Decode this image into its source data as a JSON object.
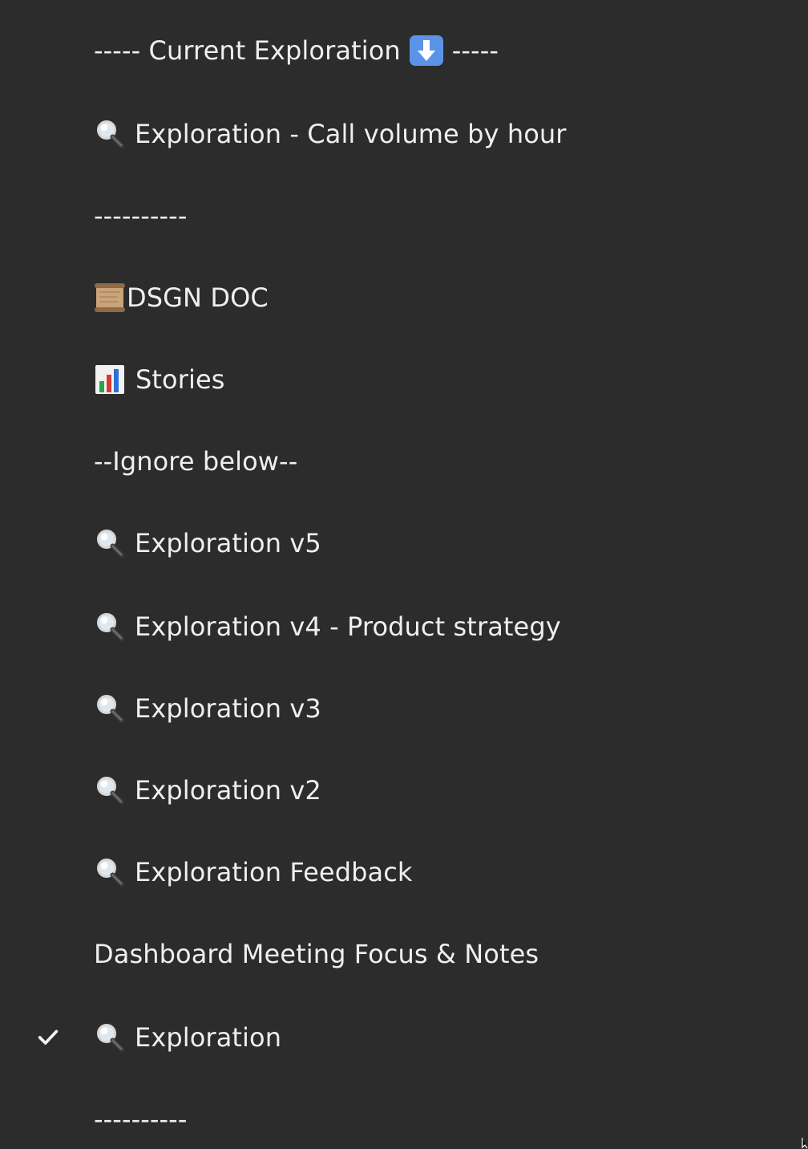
{
  "menu": {
    "items": [
      {
        "prefix": "----- Current Exploration",
        "suffix": "-----",
        "icon": "down-arrow-icon"
      },
      {
        "label": "Exploration - Call volume by hour",
        "icon": "magnifying-glass-icon"
      },
      {
        "label": "----------"
      },
      {
        "label": "DSGN DOC",
        "icon": "scroll-icon"
      },
      {
        "label": "Stories",
        "icon": "bar-chart-icon"
      },
      {
        "label": "--Ignore below--"
      },
      {
        "label": "Exploration v5",
        "icon": "magnifying-glass-icon"
      },
      {
        "label": "Exploration v4 - Product strategy",
        "icon": "magnifying-glass-icon"
      },
      {
        "label": "Exploration v3",
        "icon": "magnifying-glass-icon"
      },
      {
        "label": "Exploration v2",
        "icon": "magnifying-glass-icon"
      },
      {
        "label": "Exploration Feedback",
        "icon": "magnifying-glass-icon"
      },
      {
        "label": "Dashboard Meeting Focus & Notes"
      },
      {
        "label": "Exploration",
        "icon": "magnifying-glass-icon",
        "checked": true,
        "check_icon": "checkmark-icon"
      },
      {
        "label": "----------"
      }
    ]
  },
  "colors": {
    "background": "#2c2c2c",
    "text": "#efefef"
  }
}
